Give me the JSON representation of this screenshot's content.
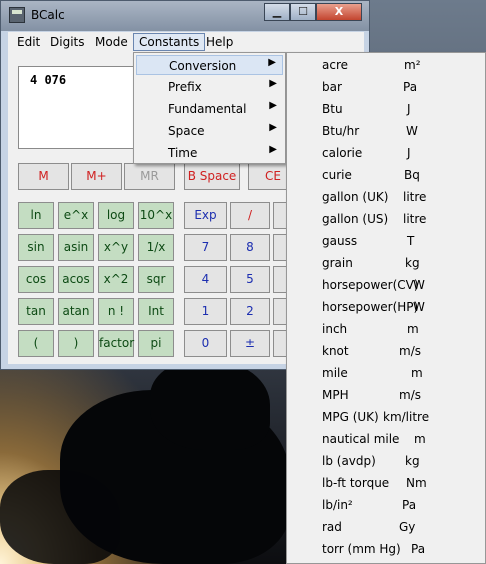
{
  "window": {
    "title": "BCalc",
    "min_label": "▁",
    "max_label": "☐",
    "close_label": "X"
  },
  "menubar": [
    "Edit",
    "Digits",
    "Mode",
    "Constants",
    "Help"
  ],
  "display": {
    "value": "4 076"
  },
  "keys": {
    "row0": [
      "M",
      "M+",
      "MR",
      "B Space",
      "CE"
    ],
    "sci": [
      [
        "ln",
        "e^x",
        "log",
        "10^x"
      ],
      [
        "sin",
        "asin",
        "x^y",
        "1/x"
      ],
      [
        "cos",
        "acos",
        "x^2",
        "sqr"
      ],
      [
        "tan",
        "atan",
        "n !",
        "Int"
      ],
      [
        "(",
        ")",
        "factor",
        "pi"
      ]
    ],
    "num": [
      [
        "Exp",
        "/"
      ],
      [
        "7",
        "8"
      ],
      [
        "4",
        "5"
      ],
      [
        "1",
        "2"
      ],
      [
        "0",
        "±"
      ]
    ]
  },
  "constants_menu": [
    "Conversion",
    "Prefix",
    "Fundamental",
    "Space",
    "Time"
  ],
  "conversion_submenu": [
    {
      "name": "acre",
      "unit": "m²"
    },
    {
      "name": "bar",
      "unit": "Pa"
    },
    {
      "name": "Btu",
      "unit": "J"
    },
    {
      "name": "Btu/hr",
      "unit": "W"
    },
    {
      "name": "calorie",
      "unit": "J"
    },
    {
      "name": "curie",
      "unit": "Bq"
    },
    {
      "name": "gallon (UK)",
      "unit": "litre"
    },
    {
      "name": "gallon (US)",
      "unit": "litre"
    },
    {
      "name": "gauss",
      "unit": "T"
    },
    {
      "name": "grain",
      "unit": "kg"
    },
    {
      "name": "horsepower(CV)",
      "unit": "W"
    },
    {
      "name": "horsepower(HP)",
      "unit": "W"
    },
    {
      "name": "inch",
      "unit": "m"
    },
    {
      "name": "knot",
      "unit": "m/s"
    },
    {
      "name": "mile",
      "unit": "m"
    },
    {
      "name": "MPH",
      "unit": "m/s"
    },
    {
      "name": "MPG (UK)",
      "unit": "km/litre"
    },
    {
      "name": "nautical mile",
      "unit": "m"
    },
    {
      "name": "lb (avdp)",
      "unit": "kg"
    },
    {
      "name": "lb-ft torque",
      "unit": "Nm"
    },
    {
      "name": "lb/in²",
      "unit": "Pa"
    },
    {
      "name": "rad",
      "unit": "Gy"
    },
    {
      "name": "torr (mm Hg)",
      "unit": "Pa"
    }
  ],
  "colors": {
    "sci_key": "#c4ddc2",
    "num_key_text": "#1c2eb0",
    "mem_key_text": "#d02020",
    "menu_highlight": "#dbe6f4"
  }
}
